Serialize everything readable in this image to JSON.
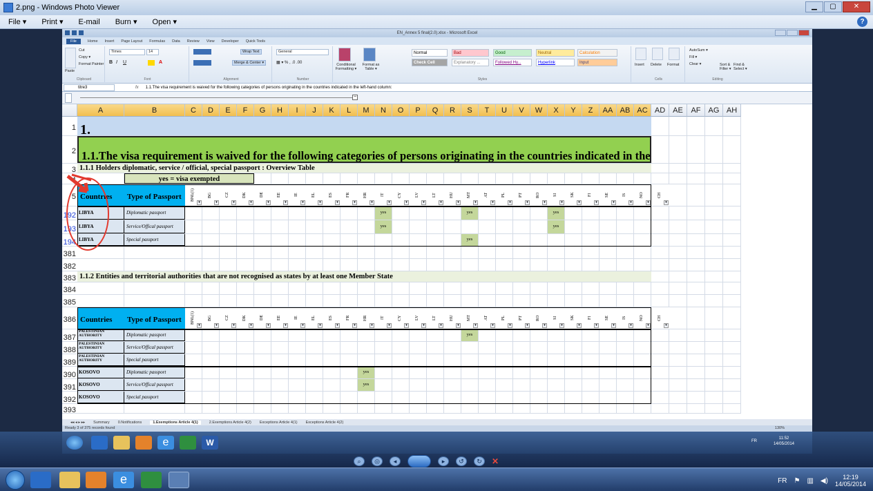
{
  "window": {
    "title": "2.png - Windows Photo Viewer"
  },
  "menu": {
    "items": [
      "File ▾",
      "Print ▾",
      "E-mail",
      "Burn ▾",
      "Open ▾"
    ],
    "help": "?"
  },
  "excel": {
    "title": "EN_Annex 5 final(2.0).xlsx - Microsoft Excel",
    "tabs": [
      "Home",
      "Insert",
      "Page Layout",
      "Formulas",
      "Data",
      "Review",
      "View",
      "Developer",
      "Quick Tools"
    ],
    "file_tab": "File",
    "ribbon": {
      "clipboard": [
        "Cut",
        "Copy ▾",
        "Format Painter",
        "Paste"
      ],
      "clipboard_label": "Clipboard",
      "font_name": "Times",
      "font_size": "14",
      "font_label": "Font",
      "alignment_label": "Alignment",
      "wrap_text": "Wrap Text",
      "merge_center": "Merge & Center ▾",
      "number_format": "General",
      "number_label": "Number",
      "cond_format": "Conditional Formatting ▾",
      "format_table": "Format as Table ▾",
      "styles": [
        {
          "label": "Normal",
          "bg": "#ffffff",
          "fg": "#000000"
        },
        {
          "label": "Bad",
          "bg": "#ffc7ce",
          "fg": "#9c0006"
        },
        {
          "label": "Good",
          "bg": "#c6efce",
          "fg": "#006100"
        },
        {
          "label": "Neutral",
          "bg": "#ffeb9c",
          "fg": "#9c6500"
        },
        {
          "label": "Calculation",
          "bg": "#f2f2f2",
          "fg": "#fa7d00"
        },
        {
          "label": "Check Cell",
          "bg": "#a5a5a5",
          "fg": "#ffffff"
        },
        {
          "label": "Explanatory ...",
          "bg": "#ffffff",
          "fg": "#7f7f7f"
        },
        {
          "label": "Followed Hy...",
          "bg": "#ffffff",
          "fg": "#800080"
        },
        {
          "label": "Hyperlink",
          "bg": "#ffffff",
          "fg": "#0000ff"
        },
        {
          "label": "Input",
          "bg": "#ffcc99",
          "fg": "#3f3f76"
        }
      ],
      "styles_label": "Styles",
      "cells": [
        "Insert",
        "Delete",
        "Format"
      ],
      "cells_label": "Cells",
      "editing": [
        "AutoSum ▾",
        "Fill ▾",
        "Clear ▾",
        "Sort & Filter ▾",
        "Find & Select ▾"
      ],
      "editing_label": "Editing"
    },
    "formula_bar": {
      "name_box": "titre3",
      "fx": "fx",
      "formula": "1.1.The visa requirement is waived for the following categories of persons originating in the countries indicated in the left-hand column:"
    },
    "columns": [
      "A",
      "B",
      "C",
      "D",
      "E",
      "F",
      "G",
      "H",
      "I",
      "J",
      "K",
      "L",
      "M",
      "N",
      "O",
      "P",
      "Q",
      "R",
      "S",
      "T",
      "U",
      "V",
      "W",
      "X",
      "Y",
      "Z",
      "AA",
      "AB",
      "AC",
      "AD",
      "AE",
      "AF",
      "AG",
      "AH"
    ],
    "rows": {
      "r1": "1.",
      "r2": "1.1.The visa requirement is waived for the following categories of persons originating in the countries indicated in the left-hand column:",
      "r3": "1.1.1 Holders diplomatic, service / official, special passport : Overview Table",
      "r4_legend": "yes = visa exempted",
      "hdr_countries": "Countries",
      "hdr_passport": "Type of Passport",
      "country_codes": [
        "BNL(1)",
        "BG",
        "CZ",
        "DK",
        "DE",
        "EE",
        "IE",
        "EL",
        "ES",
        "FR",
        "HR",
        "IT",
        "CY",
        "LV",
        "LT",
        "HU",
        "MT",
        "AT",
        "PL",
        "PT",
        "RO",
        "SI",
        "SK",
        "FI",
        "SE",
        "IS",
        "NO",
        "CH"
      ],
      "table1": [
        {
          "row": "192",
          "country": "LIBYA",
          "passport": "Diplomatic passport",
          "yes_cols": [
            "IT",
            "MT",
            "SI"
          ]
        },
        {
          "row": "193",
          "country": "LIBYA",
          "passport": "Service/Offical passport",
          "yes_cols": [
            "IT",
            "SI"
          ]
        },
        {
          "row": "194",
          "country": "LIBYA",
          "passport": "Special passport",
          "yes_cols": [
            "MT"
          ]
        }
      ],
      "blank_rows": [
        "381",
        "382"
      ],
      "r383": "1.1.2 Entities and territorial authorities that are not recognised as states by at least one Member State",
      "blank_rows2": [
        "384",
        "385"
      ],
      "hdr_row": "386",
      "table2": [
        {
          "row": "387",
          "country": "PALESTINIAN AUTHORITY",
          "passport": "Diplomatic passport",
          "yes_cols": [
            "MT"
          ]
        },
        {
          "row": "388",
          "country": "PALESTINIAN AUTHORITY",
          "passport": "Service/Offical passport",
          "yes_cols": []
        },
        {
          "row": "389",
          "country": "PALESTINIAN AUTHORITY",
          "passport": "Special passport",
          "yes_cols": []
        },
        {
          "row": "390",
          "country": "KOSOVO",
          "passport": "Diplomatic passport",
          "yes_cols": [
            "HR"
          ]
        },
        {
          "row": "391",
          "country": "KOSOVO",
          "passport": "Service/Offical passport",
          "yes_cols": [
            "HR"
          ]
        },
        {
          "row": "392",
          "country": "KOSOVO",
          "passport": "Special passport",
          "yes_cols": []
        }
      ],
      "last_row": "393",
      "yes": "yes"
    },
    "sheet_tabs": [
      "Summary",
      "0.Notifications",
      "1.Exemptions Article 4(1)",
      "2.Exemptions Article 4(2)",
      "Exceptions Article 4(1)",
      "Exceptions Article 4(2)"
    ],
    "active_sheet": "1.Exemptions Article 4(1)",
    "status": "Ready   3 of 375 records found",
    "zoom": "130%",
    "inner_clock": {
      "time": "11:52",
      "date": "14/05/2014"
    },
    "inner_lang": "FR"
  },
  "taskbar": {
    "lang": "FR",
    "time": "12:19",
    "date": "14/05/2014"
  },
  "colors": {
    "header_green": "#92d050",
    "light_green": "#ebf1de",
    "row1_blue": "#c5d9f1",
    "cyan": "#00b0f0",
    "yes_green": "#c4d79b",
    "passport_blue": "#dce6f1",
    "legend_green": "#d8e4bc"
  }
}
